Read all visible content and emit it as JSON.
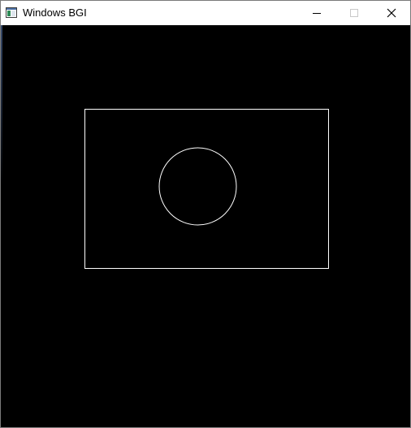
{
  "window": {
    "title": "Windows BGI",
    "icon": "bgi-app-icon",
    "controls": {
      "minimize_icon": "minimize-icon",
      "maximize_icon": "maximize-icon",
      "close_icon": "close-icon"
    }
  },
  "canvas": {
    "background_color": "#000000",
    "shapes": [
      {
        "type": "rectangle",
        "stroke": "#ffffff",
        "fill": "none"
      },
      {
        "type": "circle",
        "stroke": "#ffffff",
        "fill": "none"
      }
    ]
  }
}
